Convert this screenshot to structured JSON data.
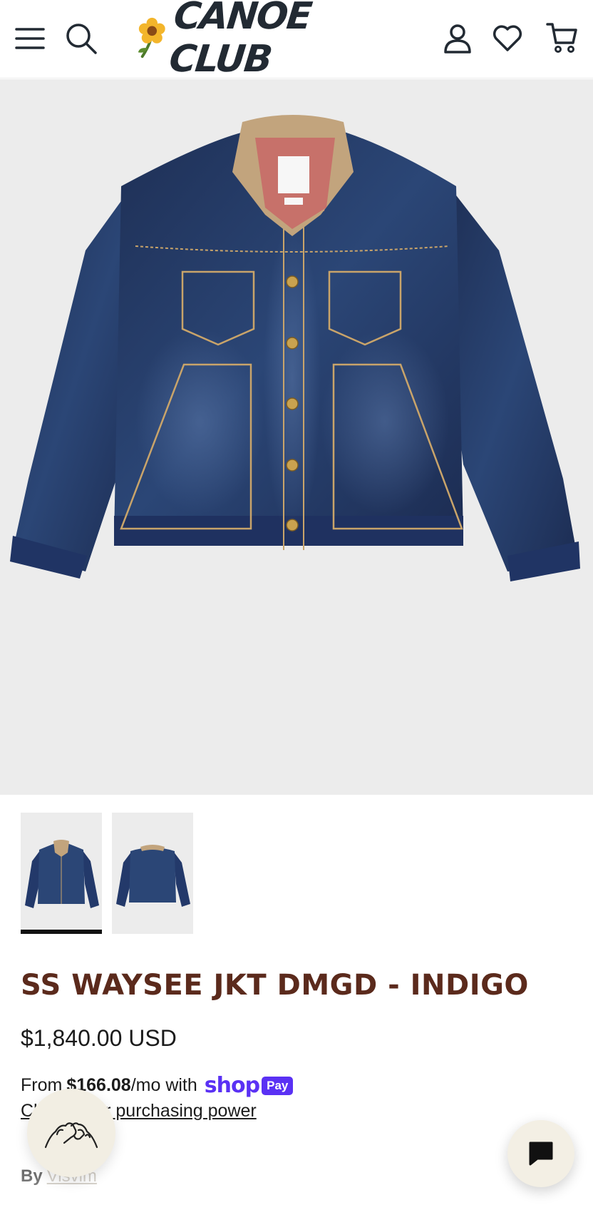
{
  "header": {
    "logo_text": "CANOE CLUB",
    "icons": [
      "menu-icon",
      "search-icon",
      "flower-icon",
      "account-icon",
      "heart-icon",
      "cart-icon"
    ]
  },
  "product": {
    "title": "SS WAYSEE JKT DMGD - INDIGO",
    "price": "$1,840.00 USD",
    "installment_prefix": "From",
    "installment_amount": "$166.08",
    "installment_suffix": "/mo with",
    "shop_word": "shop",
    "pay_badge": "Pay",
    "power_link": "Check your purchasing power",
    "by_label": "By",
    "vendor": "Visvim"
  },
  "gallery": {
    "thumbnail_count": 2,
    "selected_index": 0
  },
  "colors": {
    "title": "#5b2a1c",
    "shop_pay": "#5a31f4",
    "hero_bg": "#ececec",
    "denim": "#223a66",
    "collar": "#c2a47d"
  }
}
